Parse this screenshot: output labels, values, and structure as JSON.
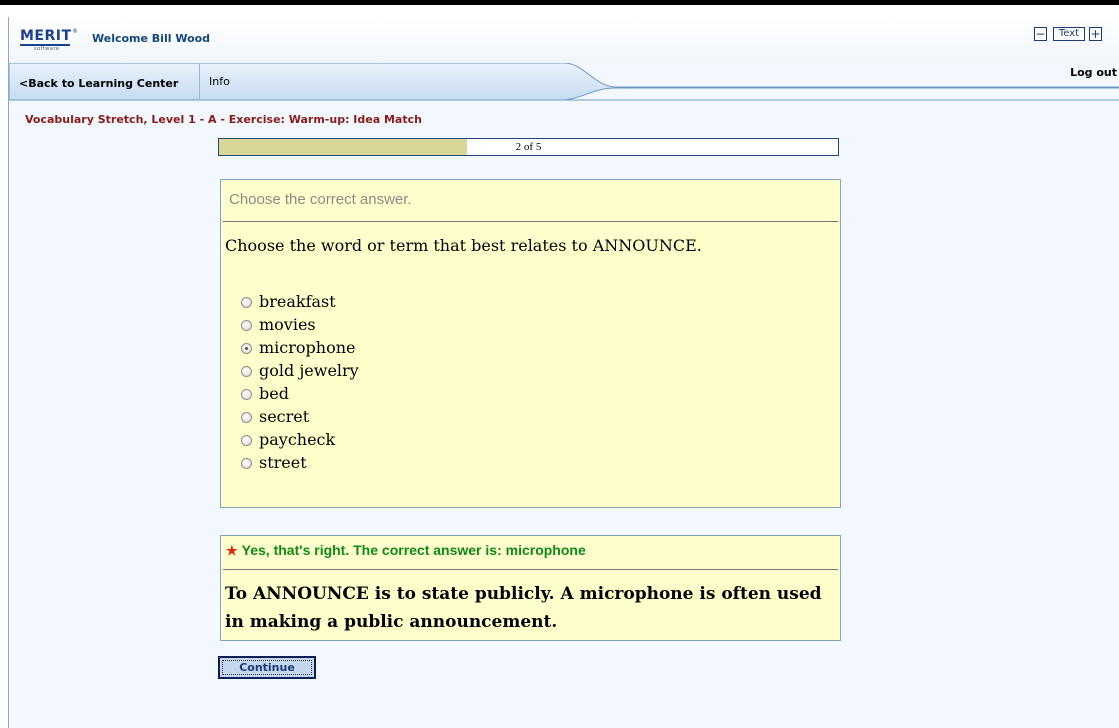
{
  "header": {
    "logo_text": "MERIT",
    "logo_subtext": "software",
    "welcome": "Welcome Bill Wood",
    "text_size": {
      "decrease": "−",
      "label": "Text",
      "increase": "+"
    }
  },
  "nav": {
    "back_link": "<Back to Learning Center",
    "info_tab": "Info",
    "logout": "Log out"
  },
  "breadcrumb": "Vocabulary Stretch, Level 1 - A - Exercise: Warm-up: Idea Match",
  "progress": {
    "label": "2 of 5",
    "fraction": 0.4
  },
  "question": {
    "instruction": "Choose the correct answer.",
    "prompt": "Choose the word or term that best relates to ANNOUNCE.",
    "options": [
      {
        "label": "breakfast",
        "selected": false
      },
      {
        "label": "movies",
        "selected": false
      },
      {
        "label": "microphone",
        "selected": true
      },
      {
        "label": "gold jewelry",
        "selected": false
      },
      {
        "label": "bed",
        "selected": false
      },
      {
        "label": "secret",
        "selected": false
      },
      {
        "label": "paycheck",
        "selected": false
      },
      {
        "label": "street",
        "selected": false
      }
    ]
  },
  "feedback": {
    "icon": "star-icon",
    "heading": "Yes, that's right. The correct answer is: microphone",
    "explanation": "To ANNOUNCE is to state publicly. A microphone is often used in making a public announcement."
  },
  "actions": {
    "continue_label": "Continue"
  },
  "colors": {
    "brand_blue": "#1d3f8f",
    "breadcrumb": "#8b1a1a",
    "panel_bg": "#ffffcc",
    "progress_fill": "#d9d697",
    "correct_green": "#0d8a1a",
    "star_red": "#d62b1a"
  }
}
